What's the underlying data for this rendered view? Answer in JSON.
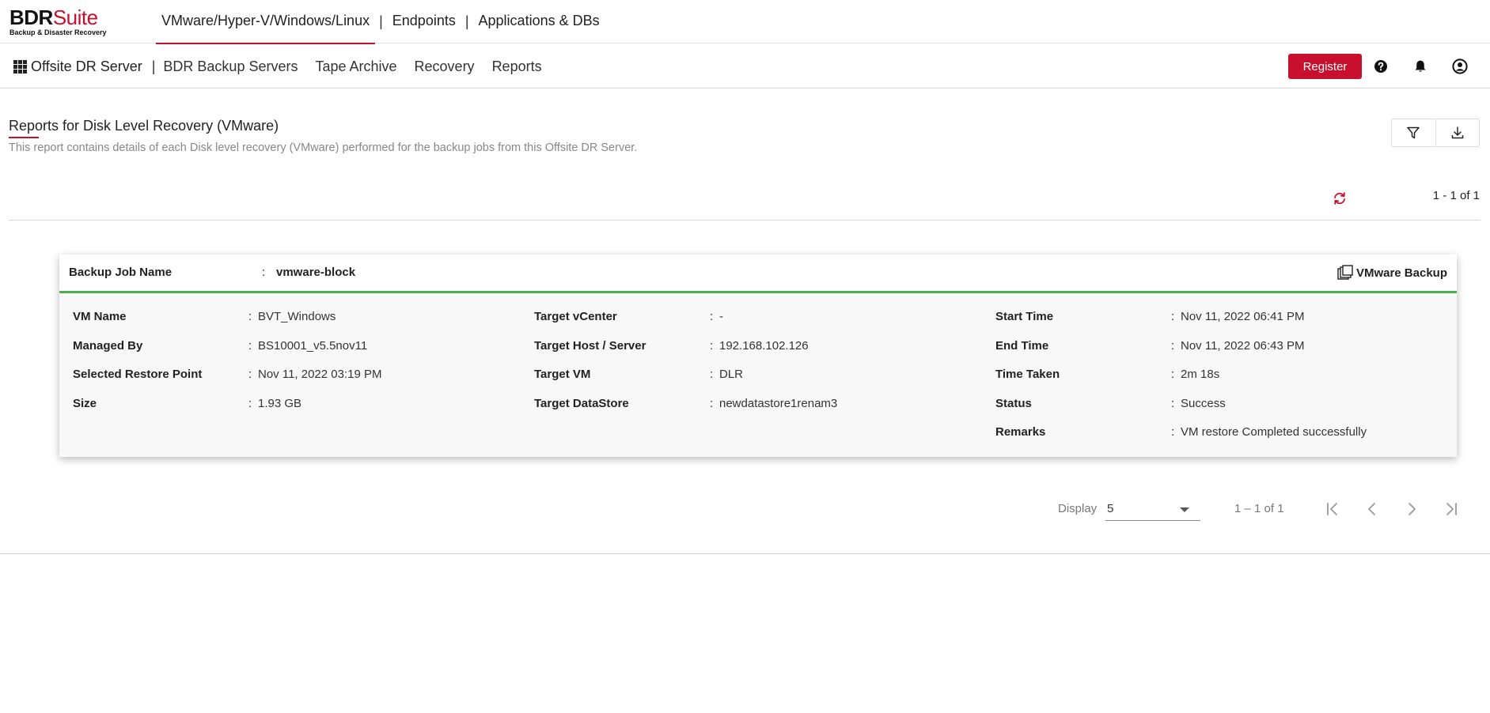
{
  "brand": {
    "name_part1": "BDR",
    "name_part2": "Suite",
    "tagline": "Backup & Disaster Recovery"
  },
  "top_nav": {
    "tabs": [
      {
        "label": "VMware/Hyper-V/Windows/Linux",
        "active": true
      },
      {
        "label": "Endpoints",
        "active": false
      },
      {
        "label": "Applications & DBs",
        "active": false
      }
    ],
    "separator": "|"
  },
  "sub_nav": {
    "server": "Offsite DR Server",
    "separator": "|",
    "items": [
      "BDR Backup Servers",
      "Tape Archive",
      "Recovery",
      "Reports"
    ],
    "register_label": "Register"
  },
  "icons": {
    "apps": "apps-grid-icon",
    "help": "help-icon",
    "notifications": "bell-icon",
    "account": "user-icon",
    "filter": "filter-icon",
    "download": "download-icon",
    "refresh": "refresh-icon",
    "job_type": "vmware-icon"
  },
  "page": {
    "title": "Reports for Disk Level Recovery (VMware)",
    "subtitle": "This report contains details of each Disk level recovery (VMware) performed for the backup jobs from this Offsite DR Server.",
    "count": "1 - 1 of 1"
  },
  "card": {
    "job_label": "Backup Job Name",
    "job_name": "vmware-block",
    "job_type": "VMware Backup",
    "columns": [
      [
        {
          "key": "VM Name",
          "value": "BVT_Windows"
        },
        {
          "key": "Managed By",
          "value": "BS10001_v5.5nov11"
        },
        {
          "key": "Selected Restore Point",
          "value": "Nov 11, 2022 03:19 PM"
        },
        {
          "key": "Size",
          "value": "1.93 GB"
        }
      ],
      [
        {
          "key": "Target vCenter",
          "value": "-"
        },
        {
          "key": "Target Host / Server",
          "value": "192.168.102.126"
        },
        {
          "key": "Target VM",
          "value": "DLR"
        },
        {
          "key": "Target DataStore",
          "value": "newdatastore1renam3"
        }
      ],
      [
        {
          "key": "Start Time",
          "value": "Nov 11, 2022 06:41 PM"
        },
        {
          "key": "End Time",
          "value": "Nov 11, 2022 06:43 PM"
        },
        {
          "key": "Time Taken",
          "value": "2m 18s"
        },
        {
          "key": "Status",
          "value": "Success"
        },
        {
          "key": "Remarks",
          "value": "VM restore Completed successfully"
        }
      ]
    ]
  },
  "pagination": {
    "display_label": "Display",
    "display_value": "5",
    "range": "1 – 1 of 1"
  },
  "colors": {
    "brand_red": "#c8102e",
    "status_green": "#4caf50"
  }
}
